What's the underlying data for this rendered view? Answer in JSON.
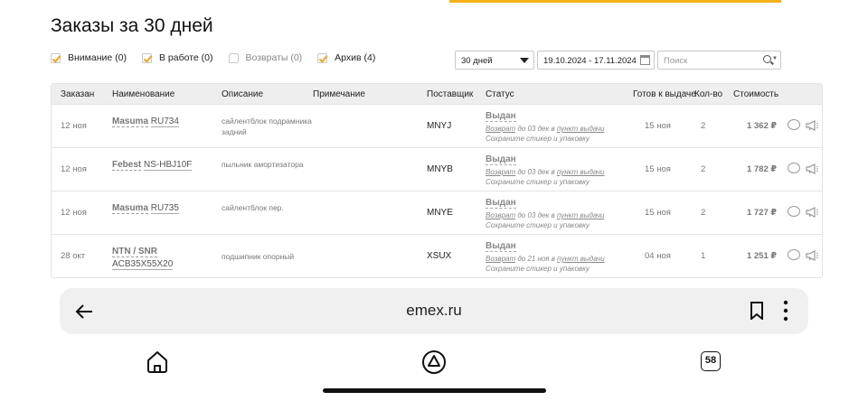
{
  "page": {
    "title": "Заказы за 30 дней"
  },
  "filters": [
    {
      "label": "Внимание (0)",
      "checked": true
    },
    {
      "label": "В работе (0)",
      "checked": true
    },
    {
      "label": "Возвраты (0)",
      "checked": false
    },
    {
      "label": "Архив (4)",
      "checked": true
    }
  ],
  "period": {
    "value": "30 дней"
  },
  "date_range": {
    "value": "19.10.2024 - 17.11.2024"
  },
  "search": {
    "placeholder": "Поиск"
  },
  "table": {
    "headers": {
      "ordered": "Заказан",
      "name": "Наименование",
      "description": "Описание",
      "note": "Примечание",
      "supplier": "Поставщик",
      "status": "Статус",
      "ready": "Готов к выдаче",
      "qty": "Кол-во",
      "price": "Стоимость"
    },
    "rows": [
      {
        "date": "12 ноя",
        "brand": "Masuma",
        "code": "RU734",
        "description": "сайлентблок подрамника задний",
        "note": "",
        "supplier": "MNYJ",
        "status": "Выдан",
        "status_link": "Возврат",
        "status_mid": " до 03 дек в ",
        "status_link2": "пункт выдачи",
        "status_note": "Сохраните стикер и упаковку",
        "ready": "15 ноя",
        "qty": "2",
        "price": "1 362 ₽"
      },
      {
        "date": "12 ноя",
        "brand": "Febest",
        "code": "NS-HBJ10F",
        "description": "пыльник амортизатора",
        "note": "",
        "supplier": "MNYB",
        "status": "Выдан",
        "status_link": "Возврат",
        "status_mid": " до 03 дек в ",
        "status_link2": "пункт выдачи",
        "status_note": "Сохраните стикер и упаковку",
        "ready": "15 ноя",
        "qty": "2",
        "price": "1 782 ₽"
      },
      {
        "date": "12 ноя",
        "brand": "Masuma",
        "code": "RU735",
        "description": "сайлентблок пер.",
        "note": "",
        "supplier": "MNYE",
        "status": "Выдан",
        "status_link": "Возврат",
        "status_mid": " до 03 дек в ",
        "status_link2": "пункт выдачи",
        "status_note": "Сохраните стикер и упаковку",
        "ready": "15 ноя",
        "qty": "2",
        "price": "1 727 ₽"
      },
      {
        "date": "28 окт",
        "brand": "NTN / SNR",
        "code": "ACB35X55X20",
        "description": "подшипник опорный",
        "note": "",
        "supplier": "XSUX",
        "status": "Выдан",
        "status_link": "Возврат",
        "status_mid": " до 21 ноя в ",
        "status_link2": "пункт выдачи",
        "status_note": "Сохраните стикер и упаковку",
        "ready": "04 ноя",
        "qty": "1",
        "price": "1 251 ₽"
      }
    ]
  },
  "browser": {
    "url": "emex.ru",
    "tab_count": "58"
  },
  "icons": {
    "back": "back-arrow-icon",
    "bookmark": "bookmark-icon",
    "menu": "kebab-menu-icon",
    "home": "home-icon",
    "assistant": "assistant-icon",
    "tabs": "tabs-icon",
    "message": "message-icon",
    "megaphone": "megaphone-icon",
    "calendar": "calendar-icon",
    "search": "search-icon"
  },
  "colors": {
    "accent": "#f5b21b",
    "check": "#f0a020"
  }
}
